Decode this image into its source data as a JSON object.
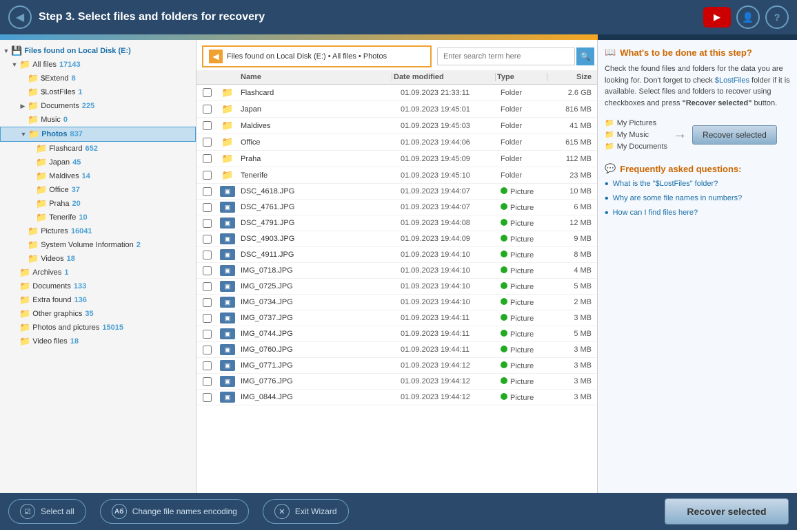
{
  "header": {
    "step_title": "Step 3.  Select files and folders for recovery",
    "back_icon": "◀",
    "yt_icon": "▶",
    "user_icon": "👤",
    "help_icon": "?"
  },
  "breadcrumb": {
    "back_icon": "◀",
    "path": "Files found on Local Disk (E:)  •  All files  •  Photos"
  },
  "search": {
    "placeholder": "Enter search term here",
    "icon": "🔍"
  },
  "tree": {
    "root_label": "Files found on Local Disk (E:)",
    "items": [
      {
        "id": "all-files",
        "label": "All files",
        "count": "17143",
        "indent": 1,
        "expanded": true,
        "has_expand": true
      },
      {
        "id": "extend",
        "label": "$Extend",
        "count": "8",
        "indent": 2,
        "expanded": false,
        "has_expand": false
      },
      {
        "id": "lostfiles",
        "label": "$LostFiles",
        "count": "1",
        "indent": 2,
        "expanded": false,
        "has_expand": false
      },
      {
        "id": "documents",
        "label": "Documents",
        "count": "225",
        "indent": 2,
        "expanded": false,
        "has_expand": true
      },
      {
        "id": "music",
        "label": "Music",
        "count": "0",
        "indent": 2,
        "expanded": false,
        "has_expand": false
      },
      {
        "id": "photos",
        "label": "Photos",
        "count": "837",
        "indent": 2,
        "expanded": true,
        "has_expand": true,
        "selected": true
      },
      {
        "id": "flashcard",
        "label": "Flashcard",
        "count": "652",
        "indent": 3,
        "expanded": false,
        "has_expand": false
      },
      {
        "id": "japan",
        "label": "Japan",
        "count": "45",
        "indent": 3,
        "expanded": false,
        "has_expand": false
      },
      {
        "id": "maldives",
        "label": "Maldives",
        "count": "14",
        "indent": 3,
        "expanded": false,
        "has_expand": false
      },
      {
        "id": "office",
        "label": "Office",
        "count": "37",
        "indent": 3,
        "expanded": false,
        "has_expand": false
      },
      {
        "id": "praha",
        "label": "Praha",
        "count": "20",
        "indent": 3,
        "expanded": false,
        "has_expand": false
      },
      {
        "id": "tenerife",
        "label": "Tenerife",
        "count": "10",
        "indent": 3,
        "expanded": false,
        "has_expand": false
      },
      {
        "id": "pictures",
        "label": "Pictures",
        "count": "16041",
        "indent": 2,
        "expanded": false,
        "has_expand": false
      },
      {
        "id": "sysvolinfo",
        "label": "System Volume Information",
        "count": "2",
        "indent": 2,
        "expanded": false,
        "has_expand": false
      },
      {
        "id": "videos",
        "label": "Videos",
        "count": "18",
        "indent": 2,
        "expanded": false,
        "has_expand": false
      },
      {
        "id": "archives",
        "label": "Archives",
        "count": "1",
        "indent": 1,
        "expanded": false,
        "has_expand": false
      },
      {
        "id": "docs2",
        "label": "Documents",
        "count": "133",
        "indent": 1,
        "expanded": false,
        "has_expand": false
      },
      {
        "id": "extrafound",
        "label": "Extra found",
        "count": "136",
        "indent": 1,
        "expanded": false,
        "has_expand": false
      },
      {
        "id": "othergraphics",
        "label": "Other graphics",
        "count": "35",
        "indent": 1,
        "expanded": false,
        "has_expand": false
      },
      {
        "id": "photospictures",
        "label": "Photos and pictures",
        "count": "15015",
        "indent": 1,
        "expanded": false,
        "has_expand": false
      },
      {
        "id": "videofiles",
        "label": "Video files",
        "count": "18",
        "indent": 1,
        "expanded": false,
        "has_expand": false
      }
    ]
  },
  "file_table": {
    "columns": [
      "",
      "",
      "Name",
      "Date modified",
      "Type",
      "Size"
    ],
    "rows": [
      {
        "name": "Flashcard",
        "date": "01.09.2023 21:33:11",
        "type": "Folder",
        "size": "2.6 GB",
        "is_folder": true,
        "has_dot": false
      },
      {
        "name": "Japan",
        "date": "01.09.2023 19:45:01",
        "type": "Folder",
        "size": "816 MB",
        "is_folder": true,
        "has_dot": false
      },
      {
        "name": "Maldives",
        "date": "01.09.2023 19:45:03",
        "type": "Folder",
        "size": "41 MB",
        "is_folder": true,
        "has_dot": false
      },
      {
        "name": "Office",
        "date": "01.09.2023 19:44:06",
        "type": "Folder",
        "size": "615 MB",
        "is_folder": true,
        "has_dot": false
      },
      {
        "name": "Praha",
        "date": "01.09.2023 19:45:09",
        "type": "Folder",
        "size": "112 MB",
        "is_folder": true,
        "has_dot": false
      },
      {
        "name": "Tenerife",
        "date": "01.09.2023 19:45:10",
        "type": "Folder",
        "size": "23 MB",
        "is_folder": true,
        "has_dot": false
      },
      {
        "name": "DSC_4618.JPG",
        "date": "01.09.2023 19:44:07",
        "type": "Picture",
        "size": "10 MB",
        "is_folder": false,
        "has_dot": true
      },
      {
        "name": "DSC_4761.JPG",
        "date": "01.09.2023 19:44:07",
        "type": "Picture",
        "size": "6 MB",
        "is_folder": false,
        "has_dot": true
      },
      {
        "name": "DSC_4791.JPG",
        "date": "01.09.2023 19:44:08",
        "type": "Picture",
        "size": "12 MB",
        "is_folder": false,
        "has_dot": true
      },
      {
        "name": "DSC_4903.JPG",
        "date": "01.09.2023 19:44:09",
        "type": "Picture",
        "size": "9 MB",
        "is_folder": false,
        "has_dot": true
      },
      {
        "name": "DSC_4911.JPG",
        "date": "01.09.2023 19:44:10",
        "type": "Picture",
        "size": "8 MB",
        "is_folder": false,
        "has_dot": true
      },
      {
        "name": "IMG_0718.JPG",
        "date": "01.09.2023 19:44:10",
        "type": "Picture",
        "size": "4 MB",
        "is_folder": false,
        "has_dot": true
      },
      {
        "name": "IMG_0725.JPG",
        "date": "01.09.2023 19:44:10",
        "type": "Picture",
        "size": "5 MB",
        "is_folder": false,
        "has_dot": true
      },
      {
        "name": "IMG_0734.JPG",
        "date": "01.09.2023 19:44:10",
        "type": "Picture",
        "size": "2 MB",
        "is_folder": false,
        "has_dot": true
      },
      {
        "name": "IMG_0737.JPG",
        "date": "01.09.2023 19:44:11",
        "type": "Picture",
        "size": "3 MB",
        "is_folder": false,
        "has_dot": true
      },
      {
        "name": "IMG_0744.JPG",
        "date": "01.09.2023 19:44:11",
        "type": "Picture",
        "size": "5 MB",
        "is_folder": false,
        "has_dot": true
      },
      {
        "name": "IMG_0760.JPG",
        "date": "01.09.2023 19:44:11",
        "type": "Picture",
        "size": "3 MB",
        "is_folder": false,
        "has_dot": true
      },
      {
        "name": "IMG_0771.JPG",
        "date": "01.09.2023 19:44:12",
        "type": "Picture",
        "size": "3 MB",
        "is_folder": false,
        "has_dot": true
      },
      {
        "name": "IMG_0776.JPG",
        "date": "01.09.2023 19:44:12",
        "type": "Picture",
        "size": "3 MB",
        "is_folder": false,
        "has_dot": true
      },
      {
        "name": "IMG_0844.JPG",
        "date": "01.09.2023 19:44:12",
        "type": "Picture",
        "size": "3 MB",
        "is_folder": false,
        "has_dot": true
      }
    ]
  },
  "right_panel": {
    "help_title": "What's to be done at this step?",
    "help_text_1": "Check the found files and folders for the data you are looking for. Don't forget to check",
    "lostfiles_link": "$LostFiles",
    "help_text_2": "folder if it is available. Select files and folders to recover using checkboxes and press",
    "recover_quote": "\"Recover selected\"",
    "help_text_3": "button.",
    "illustration": {
      "files": [
        "My Pictures",
        "My Music",
        "My Documents"
      ],
      "arrow": "→",
      "btn_label": "Recover selected"
    },
    "faq_title": "Frequently asked questions:",
    "faq_items": [
      "What is the \"$LostFiles\" folder?",
      "Why are some file names in numbers?",
      "How can I find files here?"
    ]
  },
  "bottom_bar": {
    "select_all_label": "Select all",
    "encoding_label": "Change file names encoding",
    "exit_label": "Exit Wizard",
    "recover_label": "Recover selected"
  }
}
